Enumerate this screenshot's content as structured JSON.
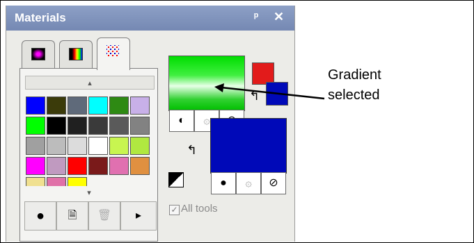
{
  "panel": {
    "title": "Materials",
    "pin_glyph": "ᵖ",
    "close_glyph": "✕"
  },
  "tabs": [
    {
      "name": "color-tab",
      "icon": "color-square-icon",
      "active": false
    },
    {
      "name": "gradient-tab",
      "icon": "gradient-icon",
      "active": false
    },
    {
      "name": "swatches-tab",
      "icon": "swatches-grid-icon",
      "active": true
    }
  ],
  "swatches": {
    "rows": [
      [
        "#0000ff",
        "#3b3b0a",
        "#5f6a7a",
        "#00ffff",
        "#2e8a13",
        "#c8b0e8"
      ],
      [
        "#00ff00",
        "#000000",
        "#202020",
        "#3a3a3a",
        "#5a5a5a",
        "#828282"
      ],
      [
        "#a0a0a0",
        "#bcbcbc",
        "#dcdcdc",
        "#ffffff",
        "#c8f550",
        "#b0e840"
      ],
      [
        "#ff00ff",
        "#c09ac0",
        "#ff0000",
        "#7a1a1a",
        "#e070b0",
        "#e09040"
      ],
      [
        "#f0e090",
        "#e070a8",
        "#ffff00"
      ]
    ]
  },
  "materials": {
    "fill_glyph": "●",
    "new_doc_glyph": "🗎",
    "trash_glyph": "🗑",
    "more_glyph": "▸",
    "style_glyph": "◐",
    "texture_glyph": "۞",
    "none_glyph": "⊘",
    "swap_glyph": "↰",
    "all_tools_label": "All tools",
    "all_tools_checked": true
  },
  "colors": {
    "foreground": "#e21b1b",
    "background": "#0009b8"
  },
  "annotation": {
    "line1": "Gradient",
    "line2": "selected"
  }
}
